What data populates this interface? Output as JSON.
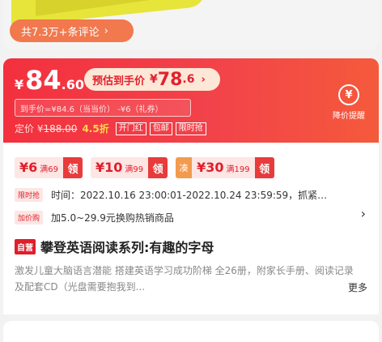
{
  "comments": {
    "label": "共7.3万+条评论"
  },
  "price": {
    "yen": "¥",
    "integer": "84",
    "decimal": ".60",
    "estimate_label": "预估到手价",
    "estimate_yen": "¥",
    "estimate_integer": "78",
    "estimate_decimal": ".6",
    "calc_text": "到手价=¥84.6（当当价） -¥6（礼券）",
    "original_prefix": "定价 ¥",
    "original_value": "188.00",
    "discount": "4.5折",
    "tags": [
      "开门红",
      "包邮",
      "限时抢"
    ],
    "drop_alert_label": "降价提醒"
  },
  "coupons": [
    {
      "amount": "¥6",
      "condition": "满69",
      "action": "领",
      "folded": false
    },
    {
      "amount": "¥10",
      "condition": "满99",
      "action": "领",
      "folded": false
    },
    {
      "amount": "¥30",
      "condition": "满199",
      "action": "领",
      "folded": true,
      "fold_label": "凑"
    }
  ],
  "promotions": [
    {
      "tag": "限时抢",
      "text": "时间：2022.10.16 23:00:01-2022.10.24 23:59:59，抓紧…"
    },
    {
      "tag": "加价购",
      "text": "加5.0~29.9元换购热销商品"
    }
  ],
  "product": {
    "badge": "自营",
    "title": "攀登英语阅读系列:有趣的字母",
    "description": "激发儿童大脑语言潜能 搭建英语学习成功阶梯 全26册，附家长手册、阅读记录及配套CD（光盘需要抱我到...",
    "more_label": "更多"
  },
  "colors": {
    "banner_red": "#f3303e",
    "accent_orange": "#f2784d"
  }
}
